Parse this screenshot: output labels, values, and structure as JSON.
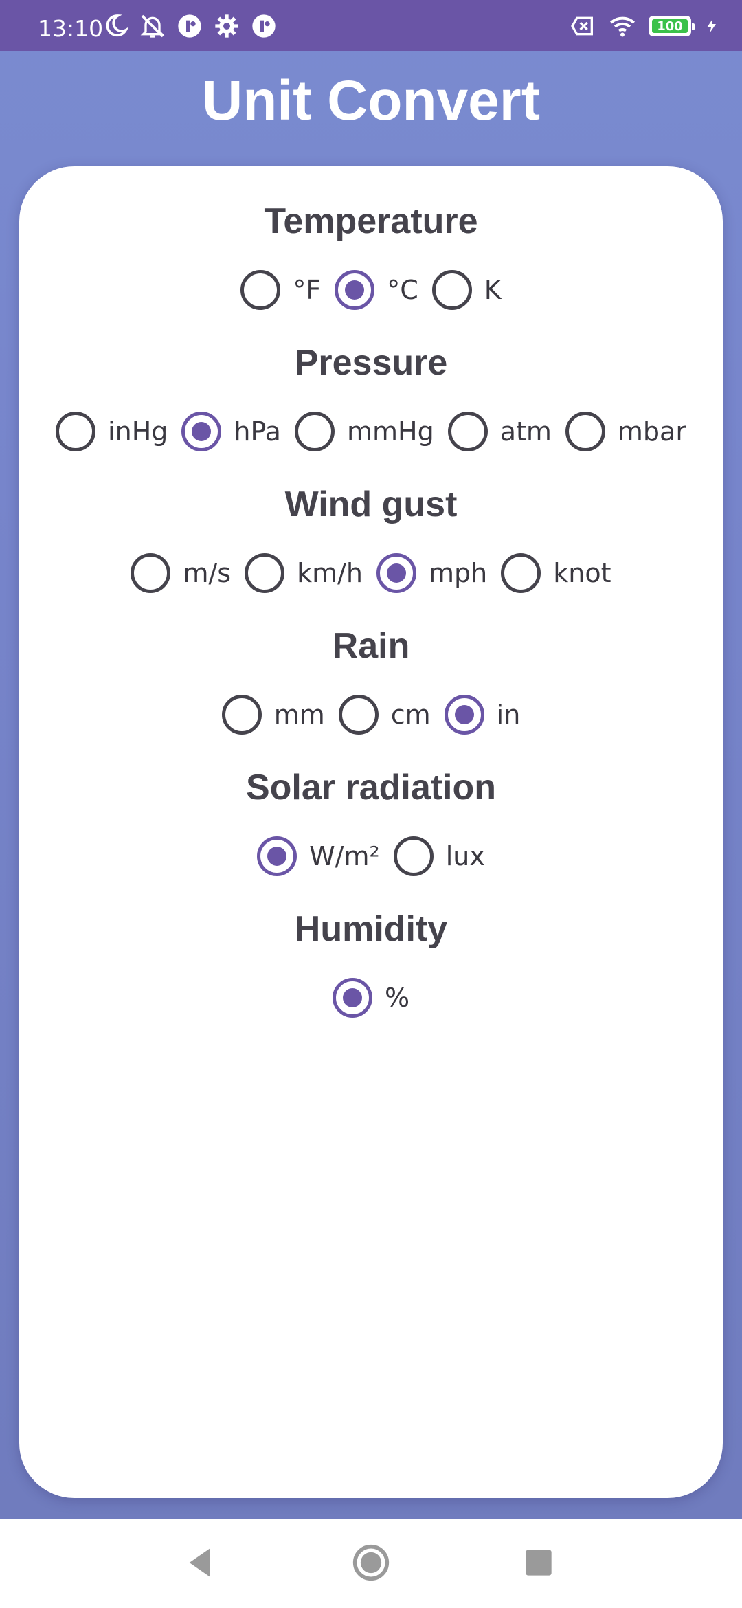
{
  "status_bar": {
    "time": "13:10",
    "battery_level": "100",
    "left_icons": [
      "moon-icon",
      "bell-muted-icon",
      "app-badge-icon",
      "settings-gear-icon",
      "app-badge-icon"
    ],
    "right_icons": [
      "no-sim-icon",
      "wifi-icon",
      "battery-icon",
      "charging-bolt-icon"
    ]
  },
  "app": {
    "title": "Unit Convert"
  },
  "sections": [
    {
      "title": "Temperature",
      "options": [
        {
          "label": "°F",
          "checked": false
        },
        {
          "label": "°C",
          "checked": true
        },
        {
          "label": "K",
          "checked": false
        }
      ]
    },
    {
      "title": "Pressure",
      "options": [
        {
          "label": "inHg",
          "checked": false
        },
        {
          "label": "hPa",
          "checked": true
        },
        {
          "label": "mmHg",
          "checked": false
        },
        {
          "label": "atm",
          "checked": false
        },
        {
          "label": "mbar",
          "checked": false
        }
      ]
    },
    {
      "title": "Wind gust",
      "options": [
        {
          "label": "m/s",
          "checked": false
        },
        {
          "label": "km/h",
          "checked": false
        },
        {
          "label": "mph",
          "checked": true
        },
        {
          "label": "knot",
          "checked": false
        }
      ]
    },
    {
      "title": "Rain",
      "options": [
        {
          "label": "mm",
          "checked": false
        },
        {
          "label": "cm",
          "checked": false
        },
        {
          "label": "in",
          "checked": true
        }
      ]
    },
    {
      "title": "Solar radiation",
      "options": [
        {
          "label": "W/m²",
          "checked": true
        },
        {
          "label": "lux",
          "checked": false
        }
      ]
    },
    {
      "title": "Humidity",
      "options": [
        {
          "label": "%",
          "checked": true
        }
      ]
    }
  ],
  "nav_bar": {
    "buttons": [
      "back-icon",
      "home-icon",
      "recents-icon"
    ]
  },
  "colors": {
    "accent": "#6a55a6",
    "background": "#7a8bd0",
    "card": "#ffffff",
    "text": "#45434c"
  }
}
